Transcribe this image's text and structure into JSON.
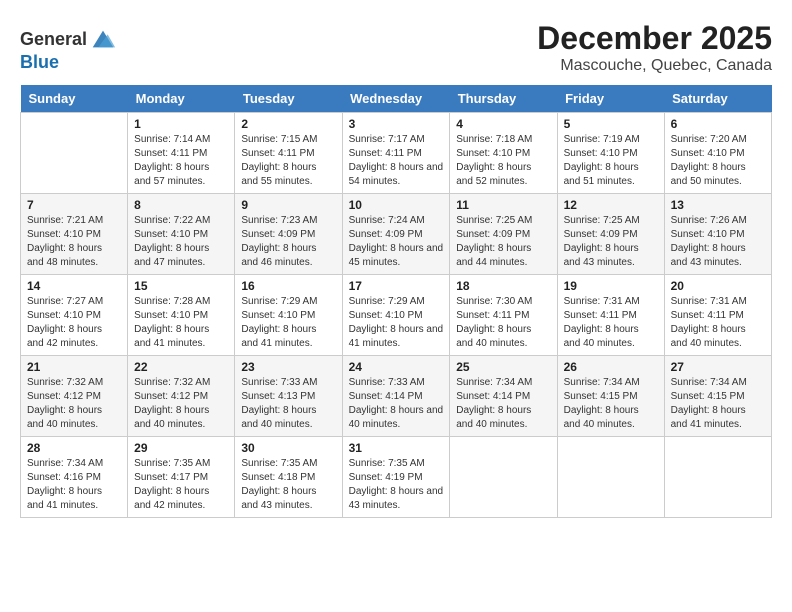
{
  "header": {
    "logo_general": "General",
    "logo_blue": "Blue",
    "month_year": "December 2025",
    "location": "Mascouche, Quebec, Canada"
  },
  "days_of_week": [
    "Sunday",
    "Monday",
    "Tuesday",
    "Wednesday",
    "Thursday",
    "Friday",
    "Saturday"
  ],
  "weeks": [
    [
      {
        "day": "",
        "sunrise": "",
        "sunset": "",
        "daylight": ""
      },
      {
        "day": "1",
        "sunrise": "Sunrise: 7:14 AM",
        "sunset": "Sunset: 4:11 PM",
        "daylight": "Daylight: 8 hours and 57 minutes."
      },
      {
        "day": "2",
        "sunrise": "Sunrise: 7:15 AM",
        "sunset": "Sunset: 4:11 PM",
        "daylight": "Daylight: 8 hours and 55 minutes."
      },
      {
        "day": "3",
        "sunrise": "Sunrise: 7:17 AM",
        "sunset": "Sunset: 4:11 PM",
        "daylight": "Daylight: 8 hours and 54 minutes."
      },
      {
        "day": "4",
        "sunrise": "Sunrise: 7:18 AM",
        "sunset": "Sunset: 4:10 PM",
        "daylight": "Daylight: 8 hours and 52 minutes."
      },
      {
        "day": "5",
        "sunrise": "Sunrise: 7:19 AM",
        "sunset": "Sunset: 4:10 PM",
        "daylight": "Daylight: 8 hours and 51 minutes."
      },
      {
        "day": "6",
        "sunrise": "Sunrise: 7:20 AM",
        "sunset": "Sunset: 4:10 PM",
        "daylight": "Daylight: 8 hours and 50 minutes."
      }
    ],
    [
      {
        "day": "7",
        "sunrise": "Sunrise: 7:21 AM",
        "sunset": "Sunset: 4:10 PM",
        "daylight": "Daylight: 8 hours and 48 minutes."
      },
      {
        "day": "8",
        "sunrise": "Sunrise: 7:22 AM",
        "sunset": "Sunset: 4:10 PM",
        "daylight": "Daylight: 8 hours and 47 minutes."
      },
      {
        "day": "9",
        "sunrise": "Sunrise: 7:23 AM",
        "sunset": "Sunset: 4:09 PM",
        "daylight": "Daylight: 8 hours and 46 minutes."
      },
      {
        "day": "10",
        "sunrise": "Sunrise: 7:24 AM",
        "sunset": "Sunset: 4:09 PM",
        "daylight": "Daylight: 8 hours and 45 minutes."
      },
      {
        "day": "11",
        "sunrise": "Sunrise: 7:25 AM",
        "sunset": "Sunset: 4:09 PM",
        "daylight": "Daylight: 8 hours and 44 minutes."
      },
      {
        "day": "12",
        "sunrise": "Sunrise: 7:25 AM",
        "sunset": "Sunset: 4:09 PM",
        "daylight": "Daylight: 8 hours and 43 minutes."
      },
      {
        "day": "13",
        "sunrise": "Sunrise: 7:26 AM",
        "sunset": "Sunset: 4:10 PM",
        "daylight": "Daylight: 8 hours and 43 minutes."
      }
    ],
    [
      {
        "day": "14",
        "sunrise": "Sunrise: 7:27 AM",
        "sunset": "Sunset: 4:10 PM",
        "daylight": "Daylight: 8 hours and 42 minutes."
      },
      {
        "day": "15",
        "sunrise": "Sunrise: 7:28 AM",
        "sunset": "Sunset: 4:10 PM",
        "daylight": "Daylight: 8 hours and 41 minutes."
      },
      {
        "day": "16",
        "sunrise": "Sunrise: 7:29 AM",
        "sunset": "Sunset: 4:10 PM",
        "daylight": "Daylight: 8 hours and 41 minutes."
      },
      {
        "day": "17",
        "sunrise": "Sunrise: 7:29 AM",
        "sunset": "Sunset: 4:10 PM",
        "daylight": "Daylight: 8 hours and 41 minutes."
      },
      {
        "day": "18",
        "sunrise": "Sunrise: 7:30 AM",
        "sunset": "Sunset: 4:11 PM",
        "daylight": "Daylight: 8 hours and 40 minutes."
      },
      {
        "day": "19",
        "sunrise": "Sunrise: 7:31 AM",
        "sunset": "Sunset: 4:11 PM",
        "daylight": "Daylight: 8 hours and 40 minutes."
      },
      {
        "day": "20",
        "sunrise": "Sunrise: 7:31 AM",
        "sunset": "Sunset: 4:11 PM",
        "daylight": "Daylight: 8 hours and 40 minutes."
      }
    ],
    [
      {
        "day": "21",
        "sunrise": "Sunrise: 7:32 AM",
        "sunset": "Sunset: 4:12 PM",
        "daylight": "Daylight: 8 hours and 40 minutes."
      },
      {
        "day": "22",
        "sunrise": "Sunrise: 7:32 AM",
        "sunset": "Sunset: 4:12 PM",
        "daylight": "Daylight: 8 hours and 40 minutes."
      },
      {
        "day": "23",
        "sunrise": "Sunrise: 7:33 AM",
        "sunset": "Sunset: 4:13 PM",
        "daylight": "Daylight: 8 hours and 40 minutes."
      },
      {
        "day": "24",
        "sunrise": "Sunrise: 7:33 AM",
        "sunset": "Sunset: 4:14 PM",
        "daylight": "Daylight: 8 hours and 40 minutes."
      },
      {
        "day": "25",
        "sunrise": "Sunrise: 7:34 AM",
        "sunset": "Sunset: 4:14 PM",
        "daylight": "Daylight: 8 hours and 40 minutes."
      },
      {
        "day": "26",
        "sunrise": "Sunrise: 7:34 AM",
        "sunset": "Sunset: 4:15 PM",
        "daylight": "Daylight: 8 hours and 40 minutes."
      },
      {
        "day": "27",
        "sunrise": "Sunrise: 7:34 AM",
        "sunset": "Sunset: 4:15 PM",
        "daylight": "Daylight: 8 hours and 41 minutes."
      }
    ],
    [
      {
        "day": "28",
        "sunrise": "Sunrise: 7:34 AM",
        "sunset": "Sunset: 4:16 PM",
        "daylight": "Daylight: 8 hours and 41 minutes."
      },
      {
        "day": "29",
        "sunrise": "Sunrise: 7:35 AM",
        "sunset": "Sunset: 4:17 PM",
        "daylight": "Daylight: 8 hours and 42 minutes."
      },
      {
        "day": "30",
        "sunrise": "Sunrise: 7:35 AM",
        "sunset": "Sunset: 4:18 PM",
        "daylight": "Daylight: 8 hours and 43 minutes."
      },
      {
        "day": "31",
        "sunrise": "Sunrise: 7:35 AM",
        "sunset": "Sunset: 4:19 PM",
        "daylight": "Daylight: 8 hours and 43 minutes."
      },
      {
        "day": "",
        "sunrise": "",
        "sunset": "",
        "daylight": ""
      },
      {
        "day": "",
        "sunrise": "",
        "sunset": "",
        "daylight": ""
      },
      {
        "day": "",
        "sunrise": "",
        "sunset": "",
        "daylight": ""
      }
    ]
  ]
}
